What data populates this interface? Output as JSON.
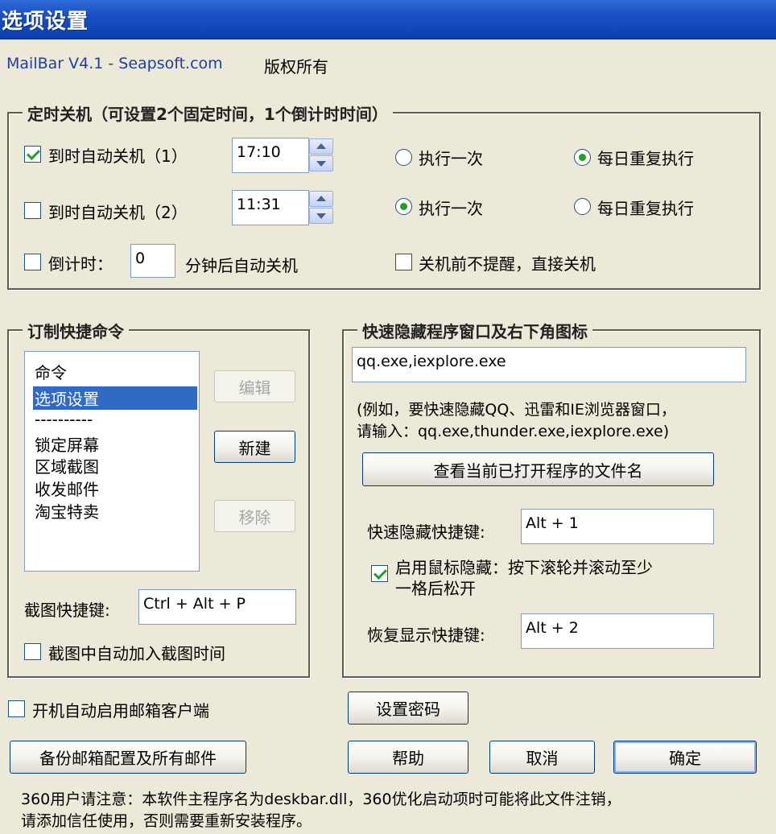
{
  "window": {
    "title": "选项设置"
  },
  "header": {
    "app_link": "MailBar V4.1 - Seapsoft.com",
    "copyright": "版权所有"
  },
  "shutdown_group": {
    "legend": "定时关机（可设置2个固定时间，1个倒计时时间）",
    "timer1": {
      "label": "到时自动关机（1）",
      "checked": true,
      "time": "17:10",
      "once_label": "执行一次",
      "daily_label": "每日重复执行",
      "selected": "daily"
    },
    "timer2": {
      "label": "到时自动关机（2）",
      "checked": false,
      "time": "11:31",
      "once_label": "执行一次",
      "daily_label": "每日重复执行",
      "selected": "once"
    },
    "countdown": {
      "label": "倒计时：",
      "checked": false,
      "value": "0",
      "suffix": "分钟后自动关机"
    },
    "no_prompt": {
      "label": "关机前不提醒，直接关机",
      "checked": false
    }
  },
  "commands_group": {
    "legend": "订制快捷命令",
    "list": [
      "命令",
      "选项设置",
      "----------",
      "锁定屏幕",
      "区域截图",
      "收发邮件",
      "淘宝特卖"
    ],
    "selected_index": 1,
    "edit_button": "编辑",
    "new_button": "新建",
    "remove_button": "移除",
    "screenshot_hotkey_label": "截图快捷键:",
    "screenshot_hotkey_value": "Ctrl + Alt + P",
    "add_time_label": "截图中自动加入截图时间",
    "add_time_checked": false
  },
  "hide_group": {
    "legend": "快速隐藏程序窗口及右下角图标",
    "programs_value": "qq.exe,iexplore.exe",
    "hint_line1": "(例如，要快速隐藏QQ、迅雷和IE浏览器窗口，",
    "hint_line2": "请输入：qq.exe,thunder.exe,iexplore.exe)",
    "view_button": "查看当前已打开程序的文件名",
    "hide_hotkey_label": "快速隐藏快捷键:",
    "hide_hotkey_value": "Alt + 1",
    "mouse_hide_line1": "启用鼠标隐藏：按下滚轮并滚动至少",
    "mouse_hide_line2": "一格后松开",
    "mouse_hide_checked": true,
    "restore_hotkey_label": "恢复显示快捷键:",
    "restore_hotkey_value": "Alt + 2"
  },
  "bottom": {
    "autostart_label": "开机自动启用邮箱客户端",
    "autostart_checked": false,
    "set_password_button": "设置密码",
    "backup_button": "备份邮箱配置及所有邮件",
    "help_button": "帮助",
    "cancel_button": "取消",
    "ok_button": "确定",
    "notice_line1": "360用户请注意：本软件主程序名为deskbar.dll，360优化启动项时可能将此文件注销，",
    "notice_line2": "请添加信任使用，否则需要重新安装程序。"
  },
  "colors": {
    "titlebar": "#1a51c4",
    "dialog_bg": "#ece9d8",
    "selection": "#316ac5",
    "check_green": "#21a121"
  }
}
